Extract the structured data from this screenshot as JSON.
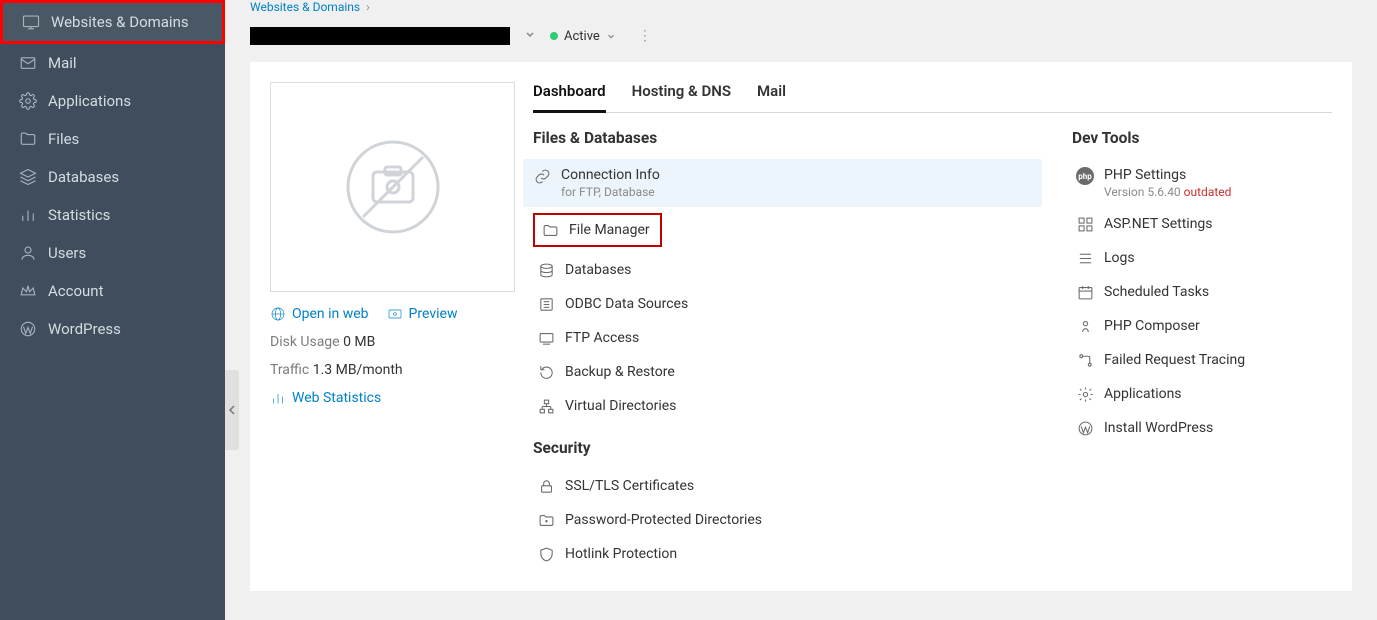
{
  "sidebar": {
    "items": [
      {
        "label": "Websites & Domains",
        "icon": "monitor"
      },
      {
        "label": "Mail",
        "icon": "mail"
      },
      {
        "label": "Applications",
        "icon": "gear"
      },
      {
        "label": "Files",
        "icon": "folder"
      },
      {
        "label": "Databases",
        "icon": "layers"
      },
      {
        "label": "Statistics",
        "icon": "bars"
      },
      {
        "label": "Users",
        "icon": "user"
      },
      {
        "label": "Account",
        "icon": "crown"
      },
      {
        "label": "WordPress",
        "icon": "wordpress"
      }
    ]
  },
  "breadcrumb": {
    "root": "Websites & Domains"
  },
  "status": {
    "label": "Active"
  },
  "preview": {
    "open_label": "Open in web",
    "preview_label": "Preview",
    "disk_usage_label": "Disk Usage",
    "disk_usage_value": "0 MB",
    "traffic_label": "Traffic",
    "traffic_value": "1.3 MB/month",
    "webstats_label": "Web Statistics"
  },
  "tabs": [
    "Dashboard",
    "Hosting & DNS",
    "Mail"
  ],
  "sections": {
    "files_db": {
      "title": "Files & Databases",
      "items": {
        "connection_info": "Connection Info",
        "connection_sub": "for FTP, Database",
        "file_manager": "File Manager",
        "databases": "Databases",
        "odbc": "ODBC Data Sources",
        "ftp": "FTP Access",
        "backup": "Backup & Restore",
        "virtual_dirs": "Virtual Directories"
      }
    },
    "security": {
      "title": "Security",
      "items": {
        "ssl": "SSL/TLS Certificates",
        "password_dirs": "Password-Protected Directories",
        "hotlink": "Hotlink Protection"
      }
    },
    "dev_tools": {
      "title": "Dev Tools",
      "items": {
        "php": "PHP Settings",
        "php_version_label": "Version 5.6.40",
        "php_outdated": "outdated",
        "aspnet": "ASP.NET Settings",
        "logs": "Logs",
        "scheduled": "Scheduled Tasks",
        "composer": "PHP Composer",
        "failed_req": "Failed Request Tracing",
        "applications": "Applications",
        "install_wp": "Install WordPress"
      }
    }
  }
}
